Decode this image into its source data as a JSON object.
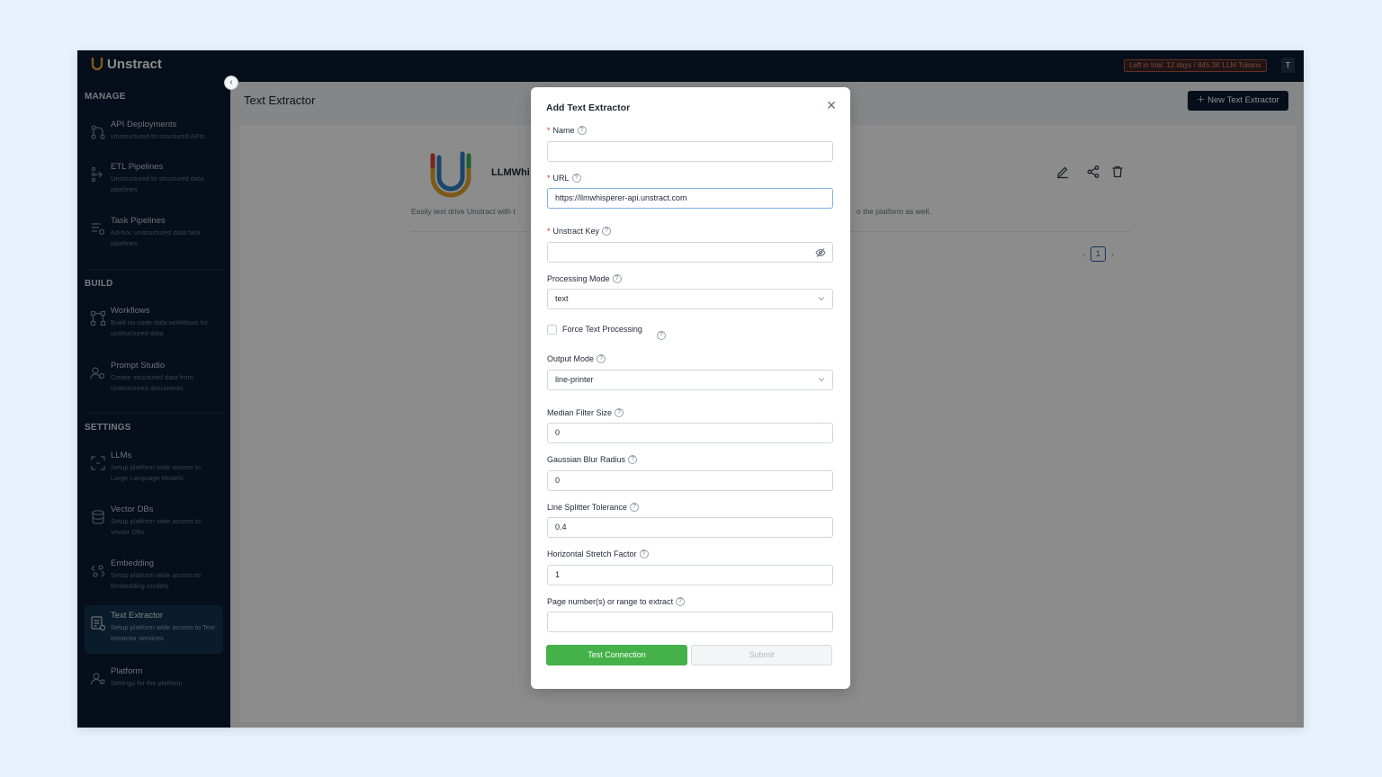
{
  "brand": {
    "name": "Unstract"
  },
  "header": {
    "trial_text": "Left in trial: 12 days / 845.3K LLM Tokens",
    "user_initial": "T"
  },
  "sidebar": {
    "sections": [
      {
        "title": "MANAGE"
      },
      {
        "title": "BUILD"
      },
      {
        "title": "SETTINGS"
      }
    ],
    "items": [
      {
        "label": "API Deployments",
        "desc": "Unstructured to structured APIs",
        "icon": "api-deployments-icon"
      },
      {
        "label": "ETL Pipelines",
        "desc": "Unstructured to structured data pipelines",
        "icon": "etl-pipelines-icon"
      },
      {
        "label": "Task Pipelines",
        "desc": "Ad-hoc unstructured data task pipelines",
        "icon": "task-pipelines-icon"
      },
      {
        "label": "Workflows",
        "desc": "Build no-code data workflows for unstructured data",
        "icon": "workflows-icon"
      },
      {
        "label": "Prompt Studio",
        "desc": "Create structured data from unstructured documents",
        "icon": "prompt-studio-icon"
      },
      {
        "label": "LLMs",
        "desc": "Setup platform wide access to Large Language Models",
        "icon": "llms-icon"
      },
      {
        "label": "Vector DBs",
        "desc": "Setup platform wide access to Vector DBs",
        "icon": "vector-db-icon"
      },
      {
        "label": "Embedding",
        "desc": "Setup platform wide access to Embedding models",
        "icon": "embedding-icon"
      },
      {
        "label": "Text Extractor",
        "desc": "Setup platform wide access to Text extractor services",
        "icon": "text-extractor-icon",
        "active": true
      },
      {
        "label": "Platform",
        "desc": "Settings for the platform",
        "icon": "platform-icon"
      }
    ],
    "collapse_icon": "chevron-left-icon"
  },
  "main": {
    "title": "Text Extractor",
    "new_button": "New Text Extractor",
    "adapter": {
      "name": "LLMWhi",
      "desc_left": "Easily test drive Unstract with t",
      "desc_right": "o the platform as well."
    },
    "pagination": {
      "current": "1"
    }
  },
  "modal": {
    "title": "Add Text Extractor",
    "fields": {
      "name": {
        "label": "Name",
        "value": ""
      },
      "url": {
        "label": "URL",
        "value": "https://llmwhisperer-api.unstract.com"
      },
      "key": {
        "label": "Unstract Key",
        "value": ""
      },
      "processing_mode": {
        "label": "Processing Mode",
        "value": "text"
      },
      "force_text": {
        "label": "Force Text Processing",
        "checked": false
      },
      "output_mode": {
        "label": "Output Mode",
        "value": "line-printer"
      },
      "median_filter": {
        "label": "Median Filter Size",
        "value": "0"
      },
      "gaussian_blur": {
        "label": "Gaussian Blur Radius",
        "value": "0"
      },
      "line_splitter": {
        "label": "Line Splitter Tolerance",
        "value": "0.4"
      },
      "horizontal_stretch": {
        "label": "Horizontal Stretch Factor",
        "value": "1"
      },
      "pages": {
        "label": "Page number(s) or range to extract",
        "value": ""
      }
    },
    "buttons": {
      "test": "Test Connection",
      "submit": "Submit"
    }
  },
  "colors": {
    "sidebar_bg": "#0a1b30",
    "active_bg": "#13344f",
    "test_button": "#44b248",
    "required": "#e02424",
    "trial_badge": "#e28866"
  }
}
